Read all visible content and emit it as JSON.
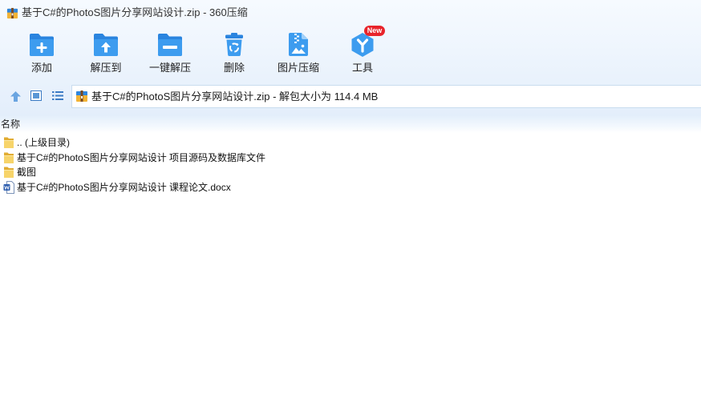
{
  "window": {
    "title": "基于C#的PhotoS图片分享网站设计.zip - 360压缩",
    "icon": "zip-archive-icon"
  },
  "toolbar": {
    "buttons": [
      {
        "label": "添加",
        "icon": "add-to-archive-icon"
      },
      {
        "label": "解压到",
        "icon": "extract-to-icon"
      },
      {
        "label": "一键解压",
        "icon": "one-click-extract-icon"
      },
      {
        "label": "删除",
        "icon": "trash-icon"
      },
      {
        "label": "图片压缩",
        "icon": "image-compress-icon"
      },
      {
        "label": "工具",
        "icon": "tools-icon",
        "badge": "New"
      }
    ]
  },
  "navigation": {
    "up_icon": "up-arrow-icon",
    "view_icons": [
      "thumbnail-view-icon",
      "list-view-icon"
    ]
  },
  "address_bar": {
    "icon": "zip-archive-icon",
    "text": "基于C#的PhotoS图片分享网站设计.zip - 解包大小为 114.4 MB"
  },
  "file_list": {
    "column_header": "名称",
    "rows": [
      {
        "icon": "folder-icon",
        "name": ".. (上级目录)"
      },
      {
        "icon": "folder-icon",
        "name": "基于C#的PhotoS图片分享网站设计 项目源码及数据库文件"
      },
      {
        "icon": "folder-icon",
        "name": "截图"
      },
      {
        "icon": "word-document-icon",
        "name": "基于C#的PhotoS图片分享网站设计 课程论文.docx"
      }
    ]
  },
  "colors": {
    "accent_blue": "#3d9cef",
    "accent_blue_dark": "#2a84df",
    "badge_red": "#e8242b",
    "folder_yellow": "#f7d46a",
    "header_bg": "#e4effb"
  }
}
